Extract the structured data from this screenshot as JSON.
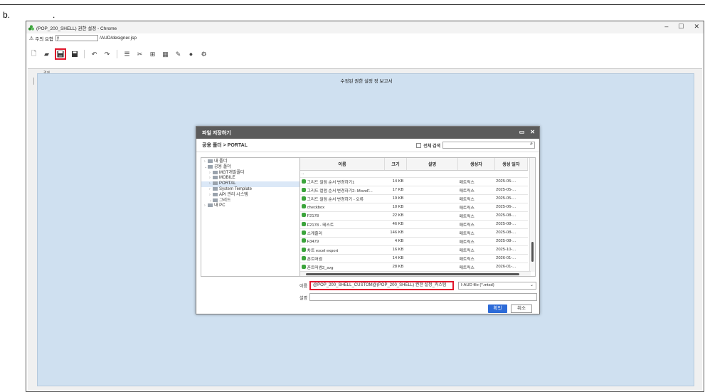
{
  "step": {
    "label": "b.",
    "dot": "."
  },
  "window": {
    "title": "(POP_200_SHELL) 권한 설정 - Chrome",
    "warning": "주의 요함",
    "address_value": "y",
    "address_path": "/AUD/designer.jsp",
    "controls": {
      "minimize": "–",
      "maximize": "☐",
      "close": "✕"
    }
  },
  "canvas": {
    "report_title": "수정된 권한 설정 정 보고서",
    "side_label": "결제"
  },
  "dialog": {
    "title": "파일 저장하기",
    "path": "공용 폴더 > PORTAL",
    "full_search_label": "전체 검색",
    "tree": [
      {
        "label": "내 폴더",
        "indent": 0,
        "arrow": "›"
      },
      {
        "label": "공용 폴더",
        "indent": 0,
        "arrow": "⌄"
      },
      {
        "label": "MGT개발폴더",
        "indent": 1,
        "arrow": "›"
      },
      {
        "label": "MOBILE",
        "indent": 1,
        "arrow": "›"
      },
      {
        "label": "PORTAL",
        "indent": 1,
        "arrow": "›",
        "selected": true
      },
      {
        "label": "System Template",
        "indent": 1,
        "arrow": "›"
      },
      {
        "label": "API 관리 시스템",
        "indent": 1,
        "arrow": "›"
      },
      {
        "label": "그리드",
        "indent": 1,
        "arrow": "⌄"
      },
      {
        "label": "내 PC",
        "indent": 0,
        "arrow": "›"
      }
    ],
    "columns": [
      "이름",
      "크기",
      "설명",
      "생성자",
      "생성 일자"
    ],
    "rows": [
      {
        "name": "..",
        "size": "",
        "desc": "",
        "creator": "",
        "date": "",
        "icon": false
      },
      {
        "name": "그리드 컬럼 순서 변경하기1",
        "size": "14 KB",
        "desc": "",
        "creator": "매트릭스",
        "date": "2025-05-...",
        "icon": true
      },
      {
        "name": "그리드 컬럼 순서 변경하기2- MoveF...",
        "size": "17 KB",
        "desc": "",
        "creator": "매트릭스",
        "date": "2025-05-...",
        "icon": true
      },
      {
        "name": "그리드 컬럼 순서 변경하기 - 오류",
        "size": "19 KB",
        "desc": "",
        "creator": "매트릭스",
        "date": "2025-05-...",
        "icon": true
      },
      {
        "name": "checkbox",
        "size": "10 KB",
        "desc": "",
        "creator": "매트릭스",
        "date": "2025-06-...",
        "icon": true
      },
      {
        "name": "F2178",
        "size": "22 KB",
        "desc": "",
        "creator": "매트릭스",
        "date": "2025-08-...",
        "icon": true
      },
      {
        "name": "F2178 - 테스트",
        "size": "46 KB",
        "desc": "",
        "creator": "매트릭스",
        "date": "2025-08-...",
        "icon": true
      },
      {
        "name": "스케줄러",
        "size": "146 KB",
        "desc": "",
        "creator": "매트릭스",
        "date": "2025-08-...",
        "icon": true
      },
      {
        "name": "F3479",
        "size": "4 KB",
        "desc": "",
        "creator": "매트릭스",
        "date": "2025-08-...",
        "icon": true
      },
      {
        "name": "차트 excel export",
        "size": "16 KB",
        "desc": "",
        "creator": "매트릭스",
        "date": "2025-10-...",
        "icon": true
      },
      {
        "name": "폰트머썸",
        "size": "14 KB",
        "desc": "",
        "creator": "매트릭스",
        "date": "2026-01-...",
        "icon": true
      },
      {
        "name": "폰트머썸2_svg",
        "size": "28 KB",
        "desc": "",
        "creator": "매트릭스",
        "date": "2026-01-...",
        "icon": true
      }
    ],
    "name_label": "이름",
    "name_value": "@POP_200_SHELL_CUSTOM@(POP_200_SHELL) 권한 설정_커스텀",
    "desc_label": "설명",
    "file_type": "I-AUD file (*.mtsd)",
    "ok_label": "확인",
    "cancel_label": "취소"
  }
}
